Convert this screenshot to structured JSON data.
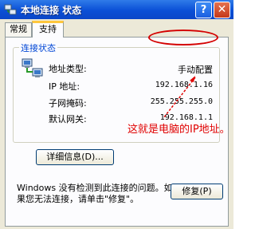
{
  "window": {
    "title": "本地连接 状态",
    "help_label": "?",
    "close_label": "✕"
  },
  "tabs": [
    {
      "label": "常规",
      "active": false
    },
    {
      "label": "支持",
      "active": true
    }
  ],
  "group": {
    "title": "连接状态",
    "rows": [
      {
        "label": "地址类型:",
        "value": "手动配置"
      },
      {
        "label": "IP 地址:",
        "value": "192.168.1.16"
      },
      {
        "label": "子网掩码:",
        "value": "255.255.255.0"
      },
      {
        "label": "默认网关:",
        "value": "192.168.1.1"
      }
    ],
    "details_button": "详细信息(D)..."
  },
  "annotation": "这就是电脑的IP地址。",
  "message": "Windows 没有检测到此连接的问题。如果您无法连接，请单击\"修复\"。",
  "repair_button": "修复(P)",
  "colors": {
    "titlebar": "#0a4fd6",
    "annotation": "#e00000",
    "group_title": "#0046d5"
  }
}
